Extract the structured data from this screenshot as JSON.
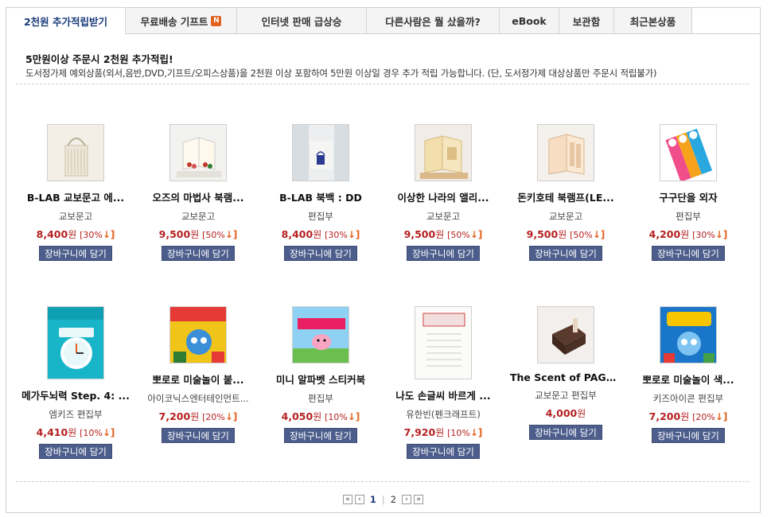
{
  "tabs": [
    {
      "label": "2천원 추가적립받기",
      "active": true
    },
    {
      "label": "무료배송 기프트",
      "badge": "N"
    },
    {
      "label": "인터넷 판매 급상승"
    },
    {
      "label": "다른사람은 뭘 샀을까?"
    },
    {
      "label": "eBook"
    },
    {
      "label": "보관함"
    },
    {
      "label": "최근본상품"
    }
  ],
  "notice": {
    "title": "5만원이상 주문시 2천원 추가적립!",
    "desc": "도서정가제 예외상품(외서,음반,DVD,기프트/오피스상품)을 2천원 이상 포함하여 5만원 이상일 경우 추가 적립 가능합니다. (단, 도서정가제 대상상품만 주문시 적립불가)"
  },
  "products_row1": [
    {
      "title": "B-LAB 교보문고 에...",
      "publisher": "교보문고",
      "price": "8,400",
      "won": "원",
      "discount": "[30%",
      "icon": "tote-bag-icon"
    },
    {
      "title": "오즈의 마법사 북램...",
      "publisher": "교보문고",
      "price": "9,500",
      "won": "원",
      "discount": "[50%",
      "icon": "book-lamp-icon"
    },
    {
      "title": "B-LAB 북백 : DD",
      "publisher": "편집부",
      "price": "8,400",
      "won": "원",
      "discount": "[30%",
      "icon": "book-bag-icon"
    },
    {
      "title": "이상한 나라의 앨리...",
      "publisher": "교보문고",
      "price": "9,500",
      "won": "원",
      "discount": "[50%",
      "icon": "book-lamp-icon"
    },
    {
      "title": "돈키호테 북램프(LE...",
      "publisher": "교보문고",
      "price": "9,500",
      "won": "원",
      "discount": "[50%",
      "icon": "book-lamp-icon"
    },
    {
      "title": "구구단을 외자",
      "publisher": "편집부",
      "price": "4,200",
      "won": "원",
      "discount": "[30%",
      "icon": "multiplication-card-icon"
    }
  ],
  "products_row2": [
    {
      "title": "메가두뇌력 Step. 4: ...",
      "publisher": "엠키즈 편집부",
      "price": "4,410",
      "won": "원",
      "discount": "[10%",
      "icon": "clock-book-icon"
    },
    {
      "title": "뽀로로 미술놀이 붙...",
      "publisher": "아이코닉스엔터테인먼트...",
      "price": "7,200",
      "won": "원",
      "discount": "[20%",
      "icon": "pororo-book-icon"
    },
    {
      "title": "미니 알파벳 스티커북",
      "publisher": "편집부",
      "price": "4,050",
      "won": "원",
      "discount": "[10%",
      "icon": "peppa-sticker-book-icon"
    },
    {
      "title": "나도 손글씨 바르게 ...",
      "publisher": "유한빈(펜크래프트)",
      "price": "7,920",
      "won": "원",
      "discount": "[10%",
      "icon": "handwriting-book-icon"
    },
    {
      "title": "The Scent of PAGE :...",
      "publisher": "교보문고 편집부",
      "price": "4,000",
      "won": "원",
      "discount": "",
      "icon": "scent-box-icon"
    },
    {
      "title": "뽀로로 미술놀이 색...",
      "publisher": "키즈아이콘 편집부",
      "price": "7,200",
      "won": "원",
      "discount": "[20%",
      "icon": "pororo-coloring-book-icon"
    }
  ],
  "cart_label": "장바구니에 담기",
  "discount_arrow": "↓]",
  "pagination": {
    "first": "«",
    "prev": "‹",
    "pages": [
      "1",
      "2"
    ],
    "current": "1",
    "next": "›",
    "last": "»"
  }
}
